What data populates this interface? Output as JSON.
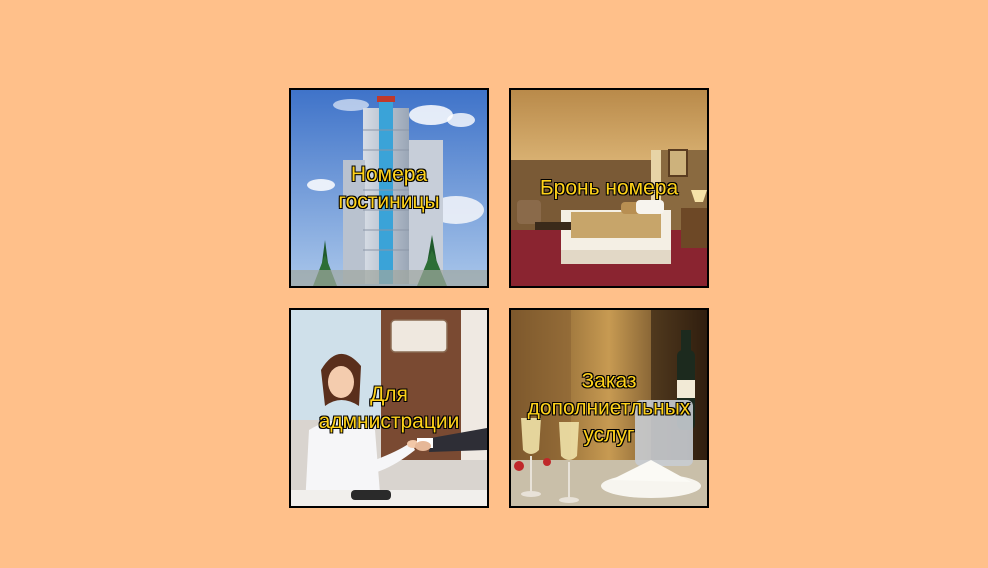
{
  "tiles": [
    {
      "id": "rooms",
      "label": "Номера\nгостиницы"
    },
    {
      "id": "booking",
      "label": "Бронь номера"
    },
    {
      "id": "admin",
      "label": "Для\nадмнистрации"
    },
    {
      "id": "services",
      "label": "Заказ\nдополниетльных\nуслуг"
    }
  ],
  "colors": {
    "background": "#ffc08a",
    "label_text": "#ffd21a",
    "label_outline": "#111111",
    "tile_border": "#000000"
  }
}
